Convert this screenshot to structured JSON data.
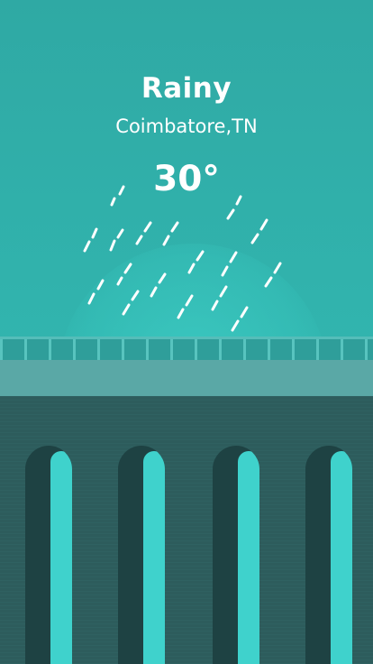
{
  "weather": {
    "condition": "Rainy",
    "location": "Coimbatore,TN",
    "temperature": "30°"
  },
  "colors": {
    "sky": "#31B3AD",
    "glow": "#42D6CD",
    "rain": "#FFFFFF",
    "railing": "#58C4BF",
    "road": "#5AA8A6",
    "bridge": "#2E5E5E",
    "arch_shadow": "#1E4243",
    "arch_light": "#3FD2CC"
  },
  "scene": {
    "illustration": "rain-over-bridge",
    "arch_count": 4
  }
}
